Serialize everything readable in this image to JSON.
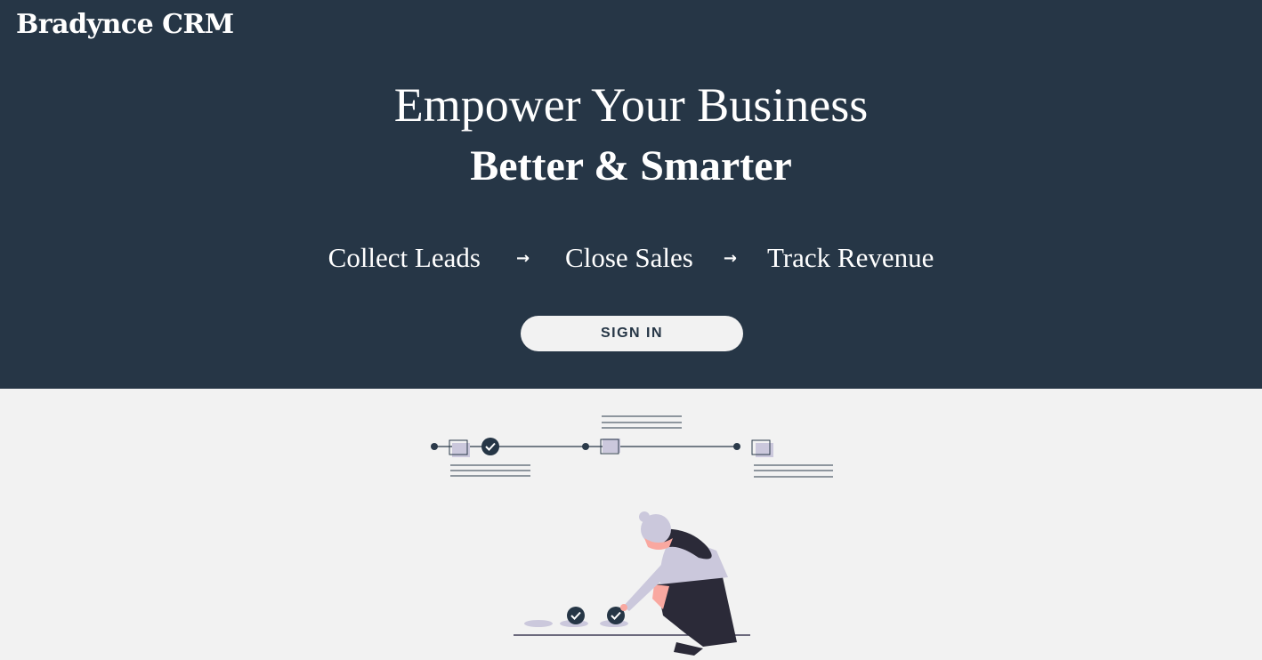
{
  "header": {
    "brand": "Bradynce CRM"
  },
  "hero": {
    "headline": "Empower Your Business",
    "subheadline": "Better & Smarter",
    "steps": [
      "Collect Leads",
      "Close Sales",
      "Track Revenue"
    ],
    "arrow_icon": "arrow-right-icon",
    "signin_label": "SIGN IN"
  },
  "illustration": {
    "name": "timeline-checklist-illustration",
    "icons": [
      "check-circle-icon",
      "person-icon"
    ]
  },
  "colors": {
    "hero_bg": "#263646",
    "page_bg": "#f2f2f2",
    "accent_lavender": "#cbc8dc",
    "accent_pink": "#f9a8a0",
    "dark": "#2b2a38"
  }
}
